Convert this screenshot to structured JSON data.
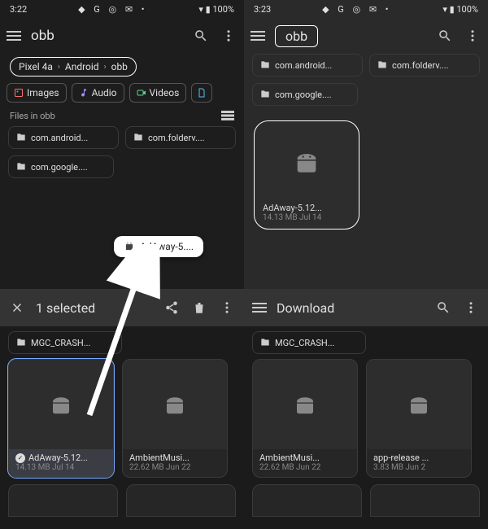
{
  "q1": {
    "status": {
      "time": "3:22",
      "icons": "◆ G ◎ ✉ •",
      "right": "▾ ▮ 100%"
    },
    "title": "obb",
    "breadcrumb": [
      "Pixel 4a",
      "Android",
      "obb"
    ],
    "chips": [
      {
        "label": "Images",
        "color": "#ff6f6f"
      },
      {
        "label": "Audio",
        "color": "#a98cff"
      },
      {
        "label": "Videos",
        "color": "#5fd28a"
      }
    ],
    "section": "Files in obb",
    "folders_row1": [
      "com.android...",
      "com.folderv...."
    ],
    "folders_row2": [
      "com.google...."
    ],
    "drag_label": "AdAway-5...."
  },
  "q2": {
    "status": {
      "time": "3:23",
      "icons": "◆ G ◎ ✉ •",
      "right": "▾ ▮ 100%"
    },
    "search": "obb",
    "folders_row1": [
      "com.android...",
      "com.folderv...."
    ],
    "folders_row2": [
      "com.google...."
    ],
    "file": {
      "name": "AdAway-5.12...",
      "meta": "14.13 MB Jul 14"
    }
  },
  "q3": {
    "title": "1 selected",
    "folder": "MGC_CRASH...",
    "files": [
      {
        "name": "AdAway-5.12...",
        "meta": "14.13 MB Jul 14",
        "selected": true
      },
      {
        "name": "AmbientMusi...",
        "meta": "22.62 MB Jun 22",
        "selected": false
      }
    ]
  },
  "q4": {
    "title": "Download",
    "folder": "MGC_CRASH...",
    "files": [
      {
        "name": "AmbientMusi...",
        "meta": "22.62 MB Jun 22"
      },
      {
        "name": "app-release ...",
        "meta": "3.83 MB Jun 2"
      }
    ]
  }
}
